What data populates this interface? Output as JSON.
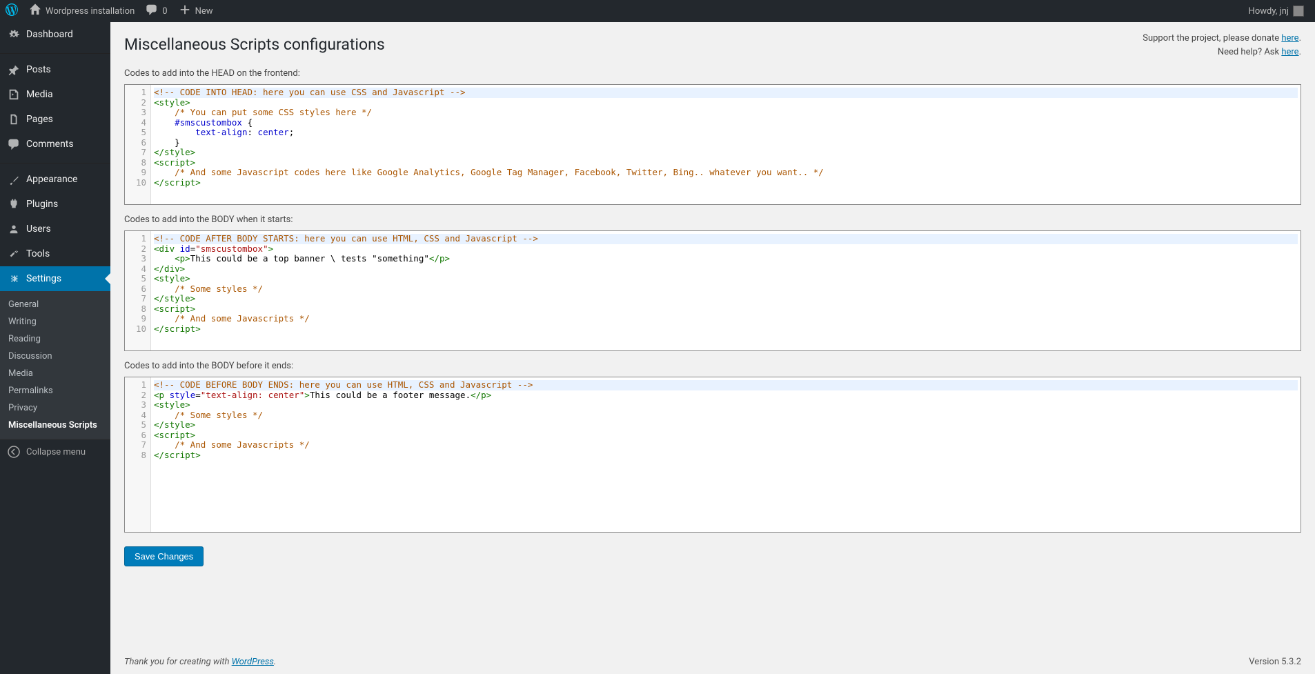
{
  "adminbar": {
    "site_name": "Wordpress installation",
    "comments_count": "0",
    "new_label": "New",
    "howdy_prefix": "Howdy, ",
    "user_name": "jnj"
  },
  "sidebar": {
    "dashboard": "Dashboard",
    "posts": "Posts",
    "media": "Media",
    "pages": "Pages",
    "comments": "Comments",
    "appearance": "Appearance",
    "plugins": "Plugins",
    "users": "Users",
    "tools": "Tools",
    "settings": "Settings",
    "submenu": {
      "general": "General",
      "writing": "Writing",
      "reading": "Reading",
      "discussion": "Discussion",
      "media": "Media",
      "permalinks": "Permalinks",
      "privacy": "Privacy",
      "misc_scripts": "Miscellaneous Scripts"
    },
    "collapse": "Collapse menu"
  },
  "page": {
    "title": "Miscellaneous Scripts configurations",
    "support_line1_text": "Support the project, please donate ",
    "support_line1_link": "here",
    "support_line2_text": "Need help? Ask ",
    "support_line2_link": "here",
    "head_label": "Codes to add into the HEAD on the frontend:",
    "body_start_label": "Codes to add into the BODY when it starts:",
    "body_end_label": "Codes to add into the BODY before it ends:",
    "save_button": "Save Changes"
  },
  "footer": {
    "thank_you_text": "Thank you for creating with ",
    "wordpress_link": "WordPress",
    "version": "Version 5.3.2"
  },
  "editors": {
    "head": {
      "line_count": 10,
      "lines_raw": [
        {
          "t": "comment",
          "content": "<!-- CODE INTO HEAD: here you can use CSS and Javascript -->"
        },
        {
          "t": "tag",
          "content": "<style>"
        },
        {
          "t": "slashcomment",
          "indent": 4,
          "content": "/* You can put some CSS styles here */"
        },
        {
          "t": "css-open",
          "indent": 4,
          "id": "#smscustombox"
        },
        {
          "t": "css-rule",
          "indent": 8,
          "prop": "text-align",
          "val": "center"
        },
        {
          "t": "css-close",
          "indent": 4
        },
        {
          "t": "tag",
          "content": "</style>"
        },
        {
          "t": "tag",
          "content": "<script>"
        },
        {
          "t": "slashcomment",
          "indent": 4,
          "content": "/* And some Javascript codes here like Google Analytics, Google Tag Manager, Facebook, Twitter, Bing.. whatever you want.. */"
        },
        {
          "t": "tag",
          "content": "</script>"
        }
      ]
    },
    "body_start": {
      "line_count": 10,
      "lines_raw": [
        {
          "t": "comment",
          "content": "<!-- CODE AFTER BODY STARTS: here you can use HTML, CSS and Javascript -->"
        },
        {
          "t": "html-open",
          "tag": "div",
          "attr": "id",
          "val": "smscustombox"
        },
        {
          "t": "html-inline",
          "indent": 4,
          "tag": "p",
          "text": "This could be a top banner \\ tests \"something\""
        },
        {
          "t": "tag",
          "content": "</div>"
        },
        {
          "t": "tag",
          "content": "<style>"
        },
        {
          "t": "slashcomment",
          "indent": 4,
          "content": "/* Some styles */"
        },
        {
          "t": "tag",
          "content": "</style>"
        },
        {
          "t": "tag",
          "content": "<script>"
        },
        {
          "t": "slashcomment",
          "indent": 4,
          "content": "/* And some Javascripts */"
        },
        {
          "t": "tag",
          "content": "</script>"
        }
      ]
    },
    "body_end": {
      "line_count": 8,
      "lines_raw": [
        {
          "t": "comment",
          "content": "<!-- CODE BEFORE BODY ENDS: here you can use HTML, CSS and Javascript -->"
        },
        {
          "t": "html-open-style",
          "tag": "p",
          "styleval": "text-align: center",
          "text": "This could be a footer message."
        },
        {
          "t": "tag",
          "content": "<style>"
        },
        {
          "t": "slashcomment",
          "indent": 4,
          "content": "/* Some styles */"
        },
        {
          "t": "tag",
          "content": "</style>"
        },
        {
          "t": "tag",
          "content": "<script>"
        },
        {
          "t": "slashcomment",
          "indent": 4,
          "content": "/* And some Javascripts */"
        },
        {
          "t": "tag",
          "content": "</script>"
        }
      ]
    }
  }
}
